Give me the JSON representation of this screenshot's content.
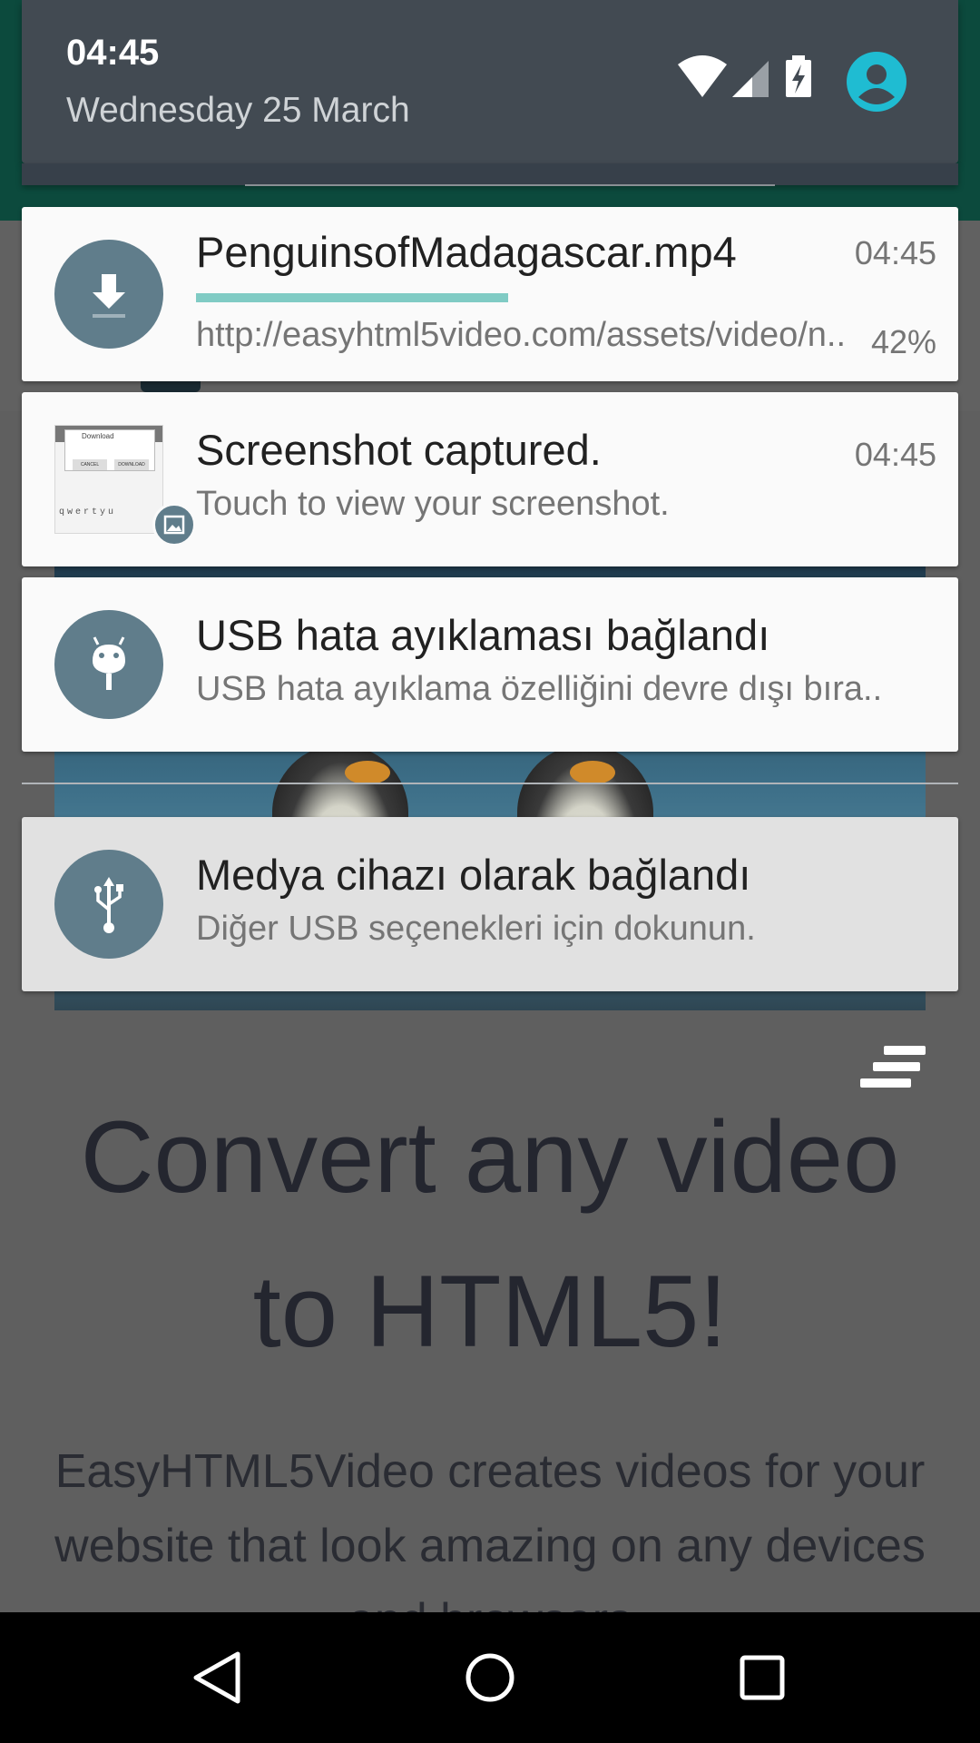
{
  "shade": {
    "time": "04:45",
    "date": "Wednesday 25 March",
    "icons": [
      "wifi-icon",
      "cell-signal-icon",
      "battery-charging-icon",
      "user-avatar-icon"
    ],
    "accent": "#1fbcd2"
  },
  "notifications": [
    {
      "title": "PenguinsofMadagascar.mp4",
      "text": "http://easyhtml5video.com/assets/video/n..",
      "time": "04:45",
      "progress_label": "42%",
      "progress": 0.42,
      "icon": "download-icon"
    },
    {
      "title": "Screenshot captured.",
      "text": "Touch to view your screenshot.",
      "time": "04:45",
      "icon": "image-icon",
      "thumbnail": {
        "dialog_title": "Download",
        "cancel": "CANCEL",
        "download": "DOWNLOAD",
        "keys": "qwertyu"
      }
    },
    {
      "title": "USB hata ayıklaması bağlandı",
      "text": "USB hata ayıklama özelliğini devre dışı bıra..",
      "icon": "android-debug-icon"
    },
    {
      "title": "Medya cihazı olarak bağlandı",
      "text": "Diğer USB seçenekleri için dokunun.",
      "icon": "usb-icon"
    }
  ],
  "page": {
    "title": "Convert any video to HTML5!",
    "description": "EasyHTML5Video creates videos for your website that look amazing on any devices and browsers"
  },
  "nav": {
    "icons": [
      "back-icon",
      "home-icon",
      "recents-icon"
    ]
  }
}
